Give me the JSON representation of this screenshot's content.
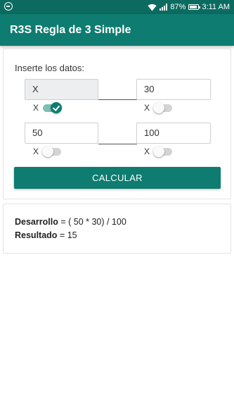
{
  "status_bar": {
    "battery": "87%",
    "battery_level": 0.87,
    "time": "3:11 AM"
  },
  "app_bar": {
    "title": "R3S Regla de 3 Simple"
  },
  "form": {
    "prompt": "Inserte los datos:",
    "fields": {
      "a": {
        "value": "X",
        "disabled": true
      },
      "b": {
        "value": "30"
      },
      "c": {
        "value": "50"
      },
      "d": {
        "value": "100"
      }
    },
    "toggles": {
      "a": {
        "label": "X",
        "on": true
      },
      "b": {
        "label": "X",
        "on": false
      },
      "c": {
        "label": "X",
        "on": false
      },
      "d": {
        "label": "X",
        "on": false
      }
    },
    "calculate_label": "CALCULAR"
  },
  "result": {
    "development_label": "Desarrollo",
    "development_value": "= ( 50 * 30) / 100",
    "result_label": "Resultado",
    "result_value": "= 15"
  },
  "colors": {
    "primary": "#0e7c70",
    "primary_dark": "#0b6b60"
  }
}
